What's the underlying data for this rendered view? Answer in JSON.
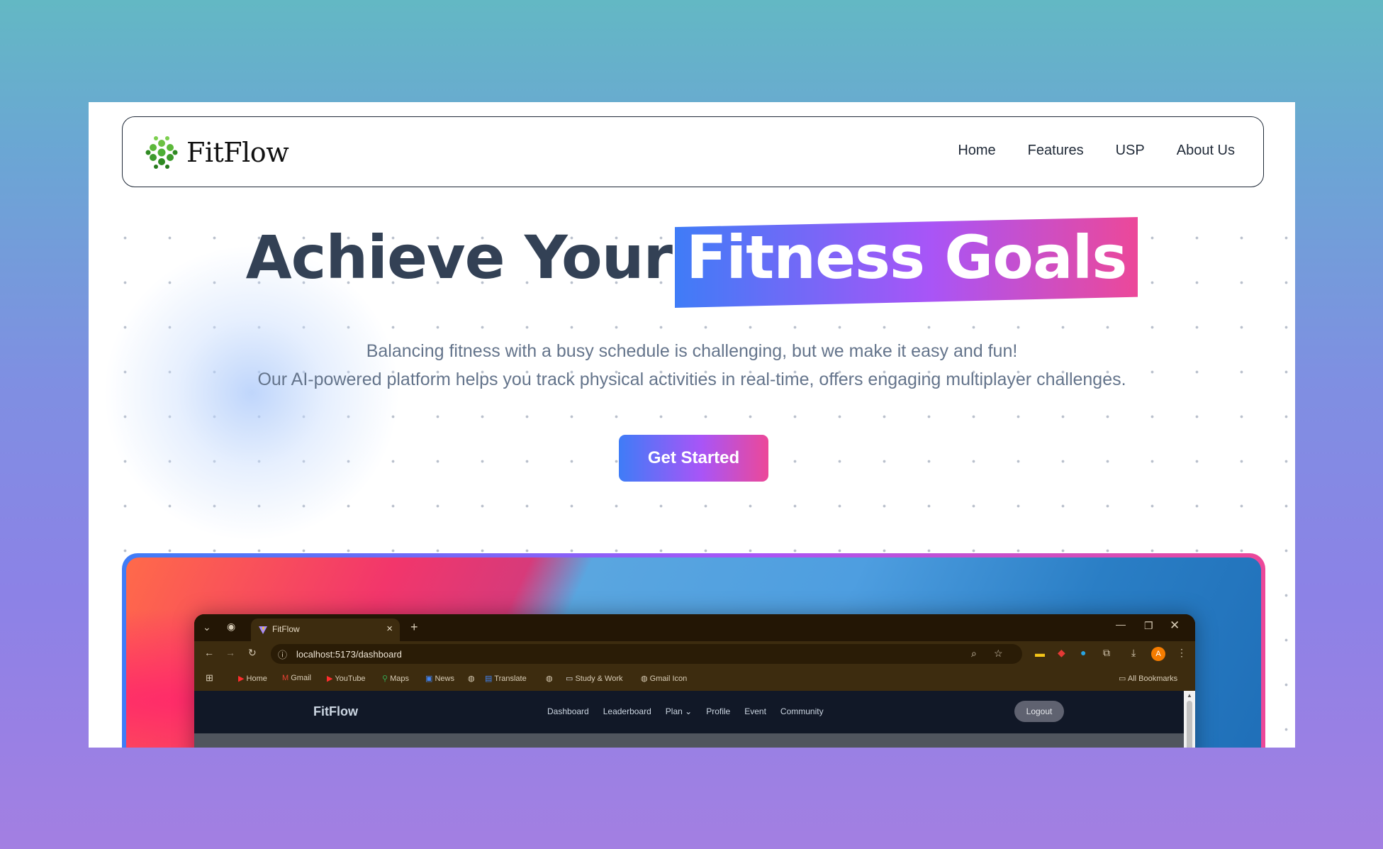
{
  "brand": {
    "name": "FitFlow"
  },
  "nav": {
    "items": [
      "Home",
      "Features",
      "USP",
      "About Us"
    ]
  },
  "hero": {
    "title_plain": "Achieve Your",
    "title_highlight": "Fitness Goals",
    "subtitle_line1": "Balancing fitness with a busy schedule is challenging, but we make it easy and fun!",
    "subtitle_line2": "Our AI-powered platform helps you track physical activities in real-time, offers engaging multiplayer challenges.",
    "cta_label": "Get Started"
  },
  "colors": {
    "gradient_start": "#3f7cf7",
    "gradient_mid": "#a855f7",
    "gradient_end": "#ec4899",
    "heading": "#334155"
  },
  "preview": {
    "tab_title": "FitFlow",
    "url": "localhost:5173/dashboard",
    "bookmarks": [
      "Home",
      "Gmail",
      "YouTube",
      "Maps",
      "News",
      "Translate",
      "Study & Work",
      "Gmail Icon"
    ],
    "all_bookmarks": "All Bookmarks",
    "profile_initial": "A",
    "site": {
      "logo": "FitFlow",
      "nav": [
        "Dashboard",
        "Leaderboard",
        "Plan",
        "Profile",
        "Event",
        "Community"
      ],
      "logout": "Logout"
    }
  }
}
